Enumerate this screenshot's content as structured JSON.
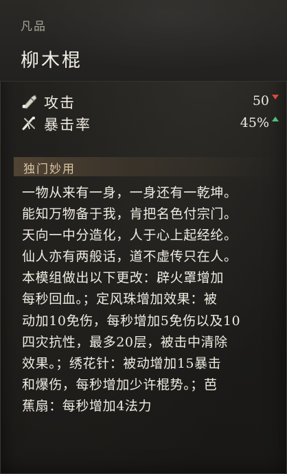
{
  "item": {
    "rarity": "凡品",
    "name": "柳木棍"
  },
  "stats": [
    {
      "label": "攻击",
      "value": "50",
      "trend": "down",
      "icon": "staff-attack-icon"
    },
    {
      "label": "暴击率",
      "value": "45%",
      "trend": "up",
      "icon": "crit-rate-icon"
    }
  ],
  "colors": {
    "trend_down": "#d94a3a",
    "trend_up": "#4fbf7a",
    "section_accent": "#d9c7a6"
  },
  "section": {
    "title": "独门妙用"
  },
  "description_lines": [
    "一物从来有一身，一身还有一乾坤。",
    "能知万物备于我，肯把名色付宗门。",
    "天向一中分造化，人于心上起经纶。",
    "仙人亦有两般话，道不虚传只在人。",
    "本模组做出以下更改：辟火罩增加",
    "每秒回血。；定风珠增加效果：被",
    "动加10免伤，每秒增加5免伤以及10",
    "四灾抗性，最多20层，被击中清除",
    "效果。；绣花针：被动增加15暴击",
    "和爆伤，每秒增加少许棍势。；芭",
    "蕉扇：每秒增加4法力"
  ]
}
